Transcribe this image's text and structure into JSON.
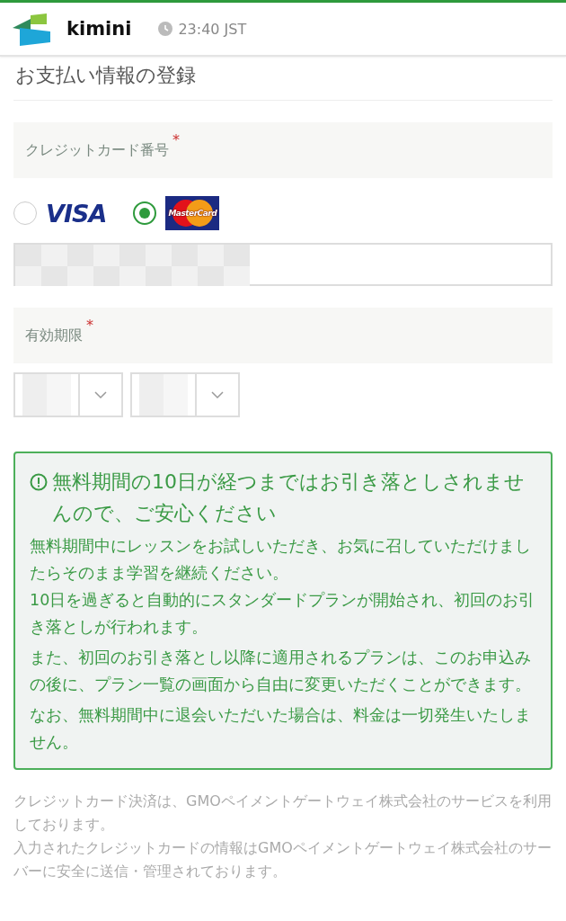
{
  "header": {
    "logo_text": "kimini",
    "time": "23:40 JST"
  },
  "title": "お支払い情報の登録",
  "card_section": {
    "label": "クレジットカード番号",
    "required_mark": "*",
    "brands": [
      {
        "kind": "visa",
        "label": "VISA",
        "selected": false
      },
      {
        "kind": "mastercard",
        "label": "MasterCard",
        "selected": true
      }
    ]
  },
  "expiry_section": {
    "label": "有効期限",
    "required_mark": "*"
  },
  "notice": {
    "headline": "無料期間の10日が経つまではお引き落としされませんので、ご安心ください",
    "paragraphs": [
      "無料期間中にレッスンをお試しいただき、お気に召していただけましたらそのまま学習を継続ください。\n10日を過ぎると自動的にスタンダードプランが開始され、初回のお引き落としが行われます。",
      "また、初回のお引き落とし以降に適用されるプランは、このお申込みの後に、プラン一覧の画面から自由に変更いただくことができます。",
      "なお、無料期間中に退会いただいた場合は、料金は一切発生いたしません。"
    ]
  },
  "footer": [
    "クレジットカード決済は、GMOペイメントゲートウェイ株式会社のサービスを利用しております。",
    "入力されたクレジットカードの情報はGMOペイメントゲートウェイ株式会社のサーバーに安全に送信・管理されております。"
  ]
}
